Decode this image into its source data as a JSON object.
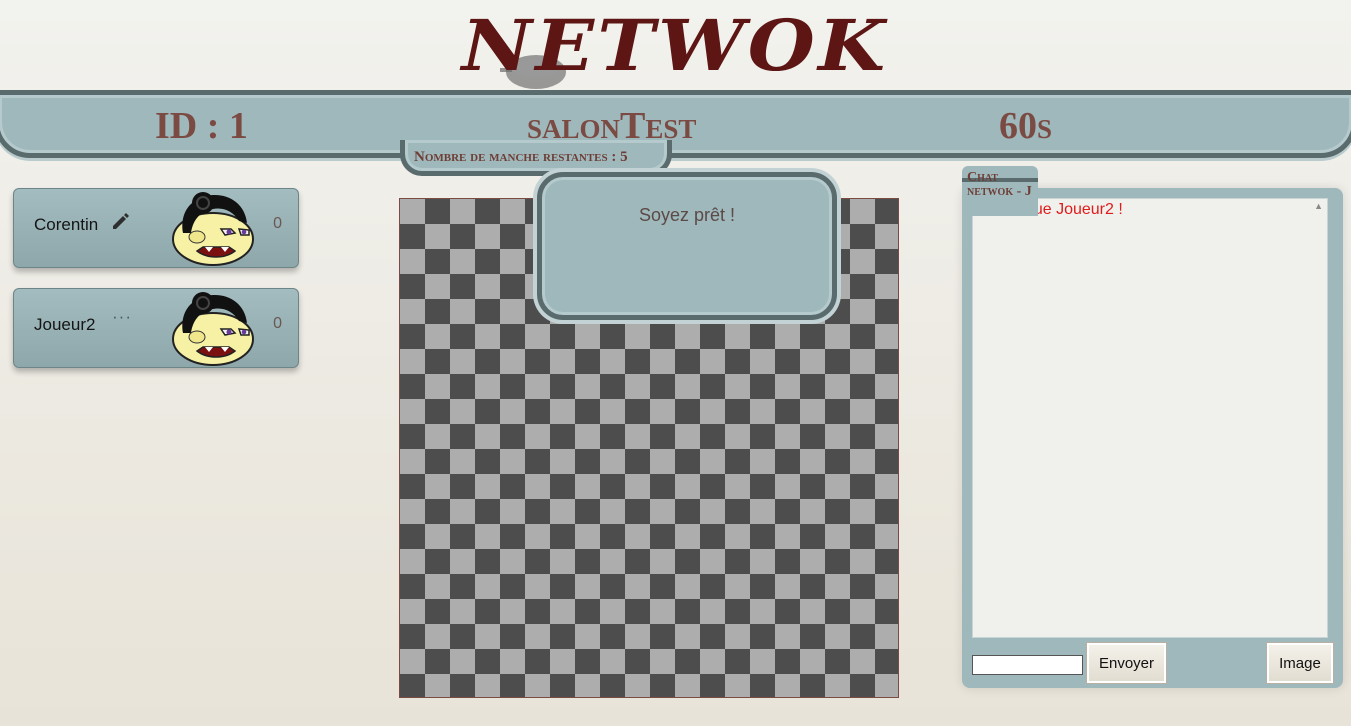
{
  "logo": {
    "text": "NETWOK",
    "icon": "wok-icon"
  },
  "banner": {
    "id_text": "ID : 1",
    "room_name": "salonTest",
    "timer": "60s",
    "rounds_remaining": "Nombre de manche restantes : 5"
  },
  "players": [
    {
      "name": "Corentin",
      "status_icon": "pencil-icon",
      "score": "0",
      "avatar": "sumo-face-avatar"
    },
    {
      "name": "Joueur2",
      "status_icon": "ellipsis-icon",
      "status_text": "···",
      "score": "0",
      "avatar": "sumo-face-avatar"
    }
  ],
  "board": {
    "rows": 20,
    "cols": 20,
    "colors": {
      "dark": "#4d4d4d",
      "light": "#adadad"
    }
  },
  "ready_popup": {
    "message": "Soyez prêt !"
  },
  "chat": {
    "tab_title": "Chat netwok - J",
    "messages": [
      {
        "text": "Bienvenue Joueur2 !",
        "color": "#e01b1b"
      }
    ],
    "input_value": "",
    "send_label": "Envoyer",
    "image_label": "Image"
  },
  "colors": {
    "panel": "#9fb8bc",
    "border": "#5a6b6d",
    "accent_text": "#7b4a42",
    "logo": "#5e1614"
  }
}
